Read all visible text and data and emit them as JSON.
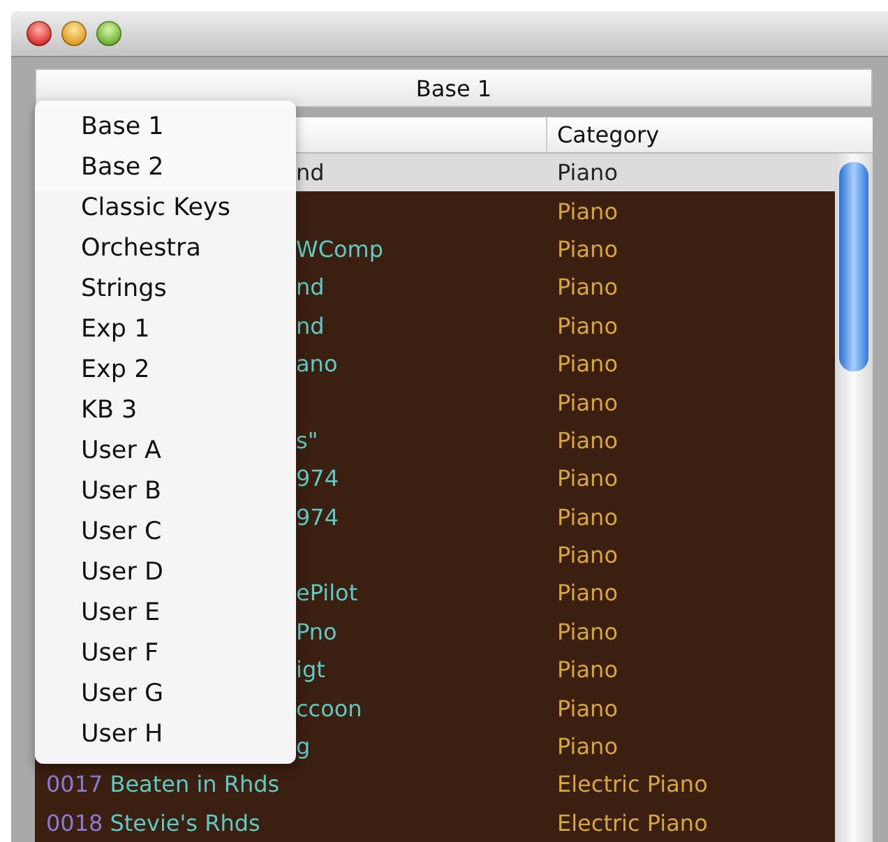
{
  "bank_popup": {
    "value": "Base 1"
  },
  "table": {
    "category_header": "Category",
    "rows": [
      {
        "kind": "partial",
        "selected": true,
        "name": "nd",
        "category": "Piano"
      },
      {
        "kind": "partial",
        "selected": false,
        "category": "Piano"
      },
      {
        "kind": "partial",
        "selected": false,
        "name": "WComp",
        "category": "Piano"
      },
      {
        "kind": "partial",
        "selected": false,
        "name": "nd",
        "category": "Piano"
      },
      {
        "kind": "partial",
        "selected": false,
        "name": "nd",
        "category": "Piano"
      },
      {
        "kind": "partial",
        "selected": false,
        "name": "ano",
        "category": "Piano"
      },
      {
        "kind": "partial",
        "selected": false,
        "category": "Piano"
      },
      {
        "kind": "partial",
        "selected": false,
        "name": "s\"",
        "category": "Piano"
      },
      {
        "kind": "partial",
        "selected": false,
        "name": "974",
        "category": "Piano"
      },
      {
        "kind": "partial",
        "selected": false,
        "name": "974",
        "category": "Piano"
      },
      {
        "kind": "partial",
        "selected": false,
        "category": "Piano"
      },
      {
        "kind": "partial",
        "selected": false,
        "name": "ePilot",
        "category": "Piano"
      },
      {
        "kind": "partial",
        "selected": false,
        "name": "Pno",
        "category": "Piano"
      },
      {
        "kind": "partial",
        "selected": false,
        "name": "igt",
        "category": "Piano"
      },
      {
        "kind": "partial",
        "selected": false,
        "name": "ccoon",
        "category": "Piano"
      },
      {
        "kind": "partial",
        "selected": false,
        "name": "g",
        "category": "Piano"
      },
      {
        "kind": "full",
        "selected": false,
        "number": "0017",
        "name": "Beaten in Rhds",
        "category": "Electric Piano"
      },
      {
        "kind": "full",
        "selected": false,
        "number": "0018",
        "name": "Stevie's Rhds",
        "category": "Electric Piano"
      }
    ]
  },
  "bank_menu": {
    "items": [
      "Base 1",
      "Base 2",
      "Classic Keys",
      "Orchestra",
      "Strings",
      "Exp 1",
      "Exp 2",
      "KB 3",
      "User A",
      "User B",
      "User C",
      "User D",
      "User E",
      "User F",
      "User G",
      "User H"
    ]
  }
}
